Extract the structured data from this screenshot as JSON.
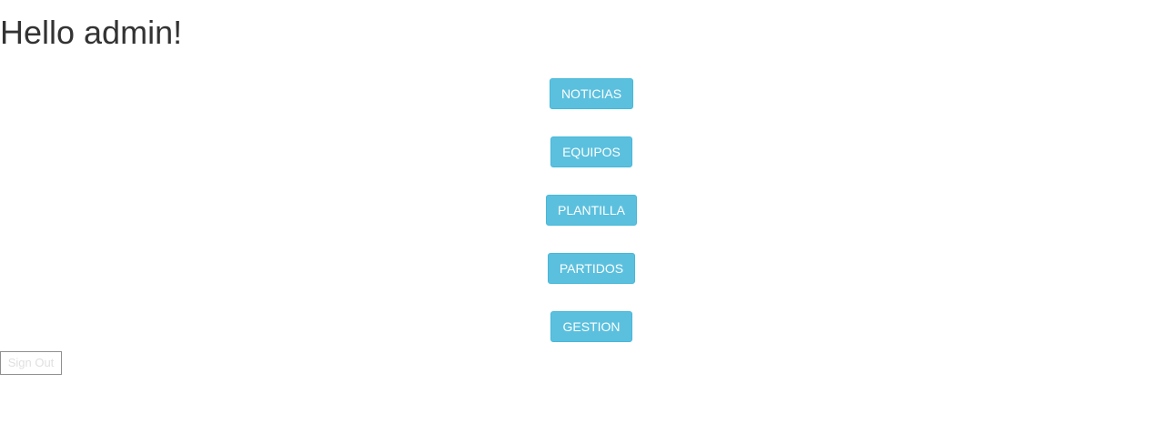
{
  "header": {
    "greeting": "Hello admin!"
  },
  "menu": {
    "items": [
      {
        "label": "NOTICIAS"
      },
      {
        "label": "EQUIPOS"
      },
      {
        "label": "PLANTILLA"
      },
      {
        "label": "PARTIDOS"
      },
      {
        "label": "GESTION"
      }
    ]
  },
  "auth": {
    "signout_label": "Sign Out"
  },
  "colors": {
    "button_bg": "#5bc0de",
    "button_border": "#46b8da",
    "button_text": "#ffffff",
    "heading_text": "#333333"
  }
}
